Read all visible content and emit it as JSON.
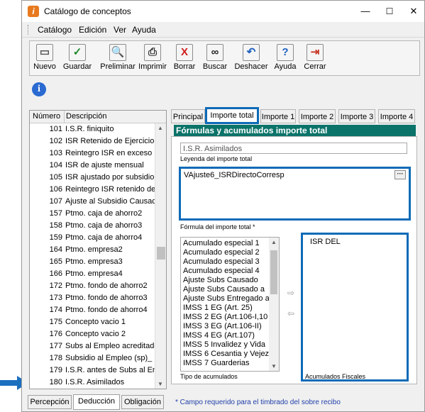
{
  "window": {
    "title": "Catálogo de conceptos",
    "minimize": "—",
    "maximize": "☐",
    "close": "✕"
  },
  "menu": [
    "Catálogo",
    "Edición",
    "Ver",
    "Ayuda"
  ],
  "toolbar": [
    {
      "label": "Nuevo",
      "icon": "new-doc-icon",
      "glyph": "▭",
      "color": "#555555"
    },
    {
      "label": "Guardar",
      "icon": "save-check-icon",
      "glyph": "✓",
      "color": "#1c8a2a"
    },
    {
      "label": "Preliminar",
      "icon": "preview-icon",
      "glyph": "🔍",
      "color": "#333333"
    },
    {
      "label": "Imprimir",
      "icon": "printer-icon",
      "glyph": "⎙",
      "color": "#333333"
    },
    {
      "label": "Borrar",
      "icon": "delete-x-icon",
      "glyph": "X",
      "color": "#d01c1c"
    },
    {
      "label": "Buscar",
      "icon": "binoculars-icon",
      "glyph": "∞",
      "color": "#222222"
    },
    {
      "label": "Deshacer",
      "icon": "undo-icon",
      "glyph": "↶",
      "color": "#1f5fbf"
    },
    {
      "label": "Ayuda",
      "icon": "help-icon",
      "glyph": "?",
      "color": "#1f5fbf"
    },
    {
      "label": "Cerrar",
      "icon": "exit-door-icon",
      "glyph": "⇥",
      "color": "#c83a2a"
    }
  ],
  "info_icon": "i",
  "list": {
    "col_number": "Número",
    "col_description": "Descripción",
    "rows": [
      {
        "num": "101",
        "desc": "I.S.R. finiquito"
      },
      {
        "num": "102",
        "desc": "ISR Retenido de Ejercicio"
      },
      {
        "num": "103",
        "desc": "Reintegro ISR en exceso"
      },
      {
        "num": "104",
        "desc": "ISR de ajuste mensual"
      },
      {
        "num": "105",
        "desc": "ISR ajustado por subsidio"
      },
      {
        "num": "106",
        "desc": "Reintegro ISR retenido de"
      },
      {
        "num": "107",
        "desc": "Ajuste al Subsidio Causad"
      },
      {
        "num": "157",
        "desc": "Ptmo. caja de ahorro2"
      },
      {
        "num": "158",
        "desc": "Ptmo. caja de ahorro3"
      },
      {
        "num": "159",
        "desc": "Ptmo. caja de ahorro4"
      },
      {
        "num": "164",
        "desc": "Ptmo. empresa2"
      },
      {
        "num": "165",
        "desc": "Ptmo. empresa3"
      },
      {
        "num": "166",
        "desc": "Ptmo. empresa4"
      },
      {
        "num": "172",
        "desc": "Ptmo. fondo de ahorro2"
      },
      {
        "num": "173",
        "desc": "Ptmo. fondo de ahorro3"
      },
      {
        "num": "174",
        "desc": "Ptmo. fondo de ahorro4"
      },
      {
        "num": "175",
        "desc": "Concepto vacio 1"
      },
      {
        "num": "176",
        "desc": "Concepto vacio 2"
      },
      {
        "num": "177",
        "desc": "Subs al Empleo acreditado"
      },
      {
        "num": "178",
        "desc": "Subsidio al Empleo (sp)_"
      },
      {
        "num": "179",
        "desc": "I.S.R. antes de Subs al Em"
      },
      {
        "num": "180",
        "desc": "I.S.R. Asimilados"
      }
    ]
  },
  "bottom_tabs": [
    "Percepción",
    "Deducción",
    "Obligación"
  ],
  "tabs": [
    "Principal",
    "Importe total",
    "Importe 1",
    "Importe 2",
    "Importe 3",
    "Importe 4"
  ],
  "section_title": "Fórmulas y acumulados importe total",
  "legend_value": "I.S.R. Asimilados",
  "legend_label": "Leyenda del importe total",
  "formula_value": "VAjuste6_ISRDirectoCorresp",
  "formula_button": "···",
  "formula_label": "Fórmula del importe total *",
  "acumulados": [
    "Acumulado especial 1",
    "Acumulado especial 2",
    "Acumulado especial 3",
    "Acumulado especial 4",
    "Ajuste Subs Causado",
    "Ajuste Subs Causado a",
    "Ajuste Subs Entregado a",
    "IMSS 1 EG (Art. 25)",
    "IMSS 2 EG (Art.106-I,10",
    "IMSS 3 EG (Art.106-II)",
    "IMSS 4 EG (Art.107)",
    "IMSS 5 Invalidez y Vida",
    "IMSS 6 Cesantia y Vejez",
    "IMSS 7 Guarderias"
  ],
  "tipo_label": "Tipo de acumulados",
  "fiscal_items": [
    "ISR DEL"
  ],
  "fiscal_label": "Acumulados Fiscales",
  "footer": "* Campo requerido para el timbrado del sobre recibo",
  "colors": {
    "accent": "#0e6bb7",
    "section": "#0b7369",
    "footer": "#1f3fa8"
  }
}
